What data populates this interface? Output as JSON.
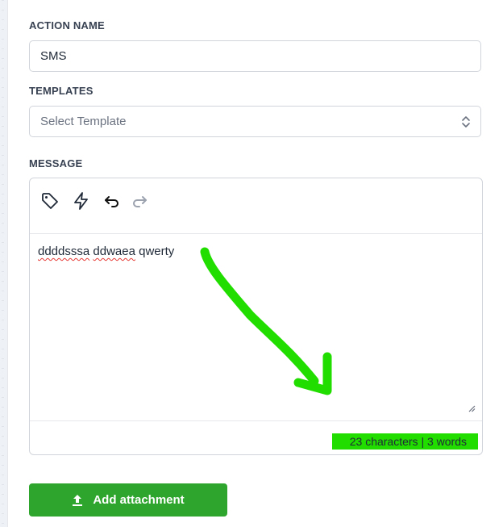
{
  "action_name": {
    "label": "ACTION NAME",
    "value": "SMS"
  },
  "templates": {
    "label": "TEMPLATES",
    "placeholder": "Select Template"
  },
  "message": {
    "label": "MESSAGE",
    "toolbar_icons": [
      "tag-icon",
      "lightning-icon",
      "undo-icon",
      "redo-icon"
    ],
    "words": [
      "ddddsssa",
      "ddwaea",
      "qwerty"
    ],
    "counter": "23 characters | 3 words"
  },
  "attachment_button": {
    "label": "Add attachment",
    "icon": "upload-icon"
  },
  "colors": {
    "accent_green": "#2ea52c",
    "annotation_green": "#22dd00",
    "spellcheck_red": "#e53935"
  }
}
